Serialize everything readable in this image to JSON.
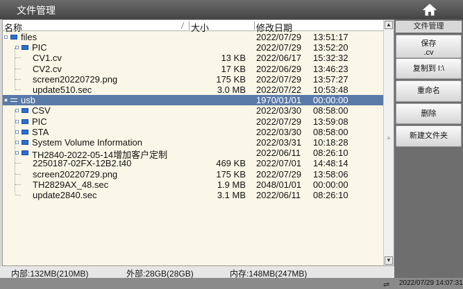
{
  "window": {
    "title": "文件管理"
  },
  "columns": {
    "name": "名称",
    "size": "大小",
    "date": "修改日期"
  },
  "rows": [
    {
      "name": "files",
      "size": "",
      "date": "2022/07/29",
      "time": "13:51:17",
      "kind": "folder",
      "level": 0
    },
    {
      "name": "PIC",
      "size": "",
      "date": "2022/07/29",
      "time": "13:52:20",
      "kind": "folder",
      "level": 1
    },
    {
      "name": "CV1.cv",
      "size": "13 KB",
      "date": "2022/06/17",
      "time": "15:32:32",
      "kind": "file",
      "level": 1
    },
    {
      "name": "CV2.cv",
      "size": "17 KB",
      "date": "2022/06/29",
      "time": "13:46:23",
      "kind": "file",
      "level": 1
    },
    {
      "name": "screen20220729.png",
      "size": "175 KB",
      "date": "2022/07/29",
      "time": "13:57:27",
      "kind": "file",
      "level": 1
    },
    {
      "name": "update510.sec",
      "size": "3.0 MB",
      "date": "2022/07/22",
      "time": "10:53:48",
      "kind": "file",
      "level": 1
    },
    {
      "name": "usb",
      "size": "",
      "date": "1970/01/01",
      "time": "00:00:00",
      "kind": "drive",
      "level": 0,
      "selected": true
    },
    {
      "name": "CSV",
      "size": "",
      "date": "2022/03/30",
      "time": "08:58:00",
      "kind": "folder",
      "level": 1
    },
    {
      "name": "PIC",
      "size": "",
      "date": "2022/07/29",
      "time": "13:59:08",
      "kind": "folder",
      "level": 1
    },
    {
      "name": "STA",
      "size": "",
      "date": "2022/03/30",
      "time": "08:58:00",
      "kind": "folder",
      "level": 1
    },
    {
      "name": "System Volume Information",
      "size": "",
      "date": "2022/03/31",
      "time": "10:18:28",
      "kind": "folder",
      "level": 1
    },
    {
      "name": "TH2840-2022-05-14增加客户定制",
      "size": "",
      "date": "2022/06/11",
      "time": "08:26:10",
      "kind": "folder",
      "level": 1
    },
    {
      "name": "2250187-02FX-12B2.t40",
      "size": "469 KB",
      "date": "2022/07/01",
      "time": "14:48:14",
      "kind": "file",
      "level": 1
    },
    {
      "name": "screen20220729.png",
      "size": "175 KB",
      "date": "2022/07/29",
      "time": "13:58:06",
      "kind": "file",
      "level": 1
    },
    {
      "name": "TH2829AX_48.sec",
      "size": "1.9 MB",
      "date": "2048/01/01",
      "time": "00:00:00",
      "kind": "file",
      "level": 1
    },
    {
      "name": "update2840.sec",
      "size": "3.1 MB",
      "date": "2022/06/11",
      "time": "08:26:10",
      "kind": "file",
      "level": 1
    }
  ],
  "status": {
    "internal": "内部:132MB(210MB)",
    "external": "外部:28GB(28GB)",
    "memory": "内存:148MB(247MB)"
  },
  "sidebar": {
    "title": "文件管理",
    "save_label": "保存",
    "save_sub": ".cv",
    "copy_label": "复制到 I:\\",
    "rename_label": "重命名",
    "delete_label": "删除",
    "newfolder_label": "新建文件夹"
  },
  "clock": "2022/07/29 14:07:31",
  "icons": {
    "home": "home-icon",
    "usb": "usb-icon"
  },
  "colors": {
    "selection": "#5a7aa8",
    "folder": "#2d6fd0",
    "list_bg": "#fbf7e8"
  }
}
